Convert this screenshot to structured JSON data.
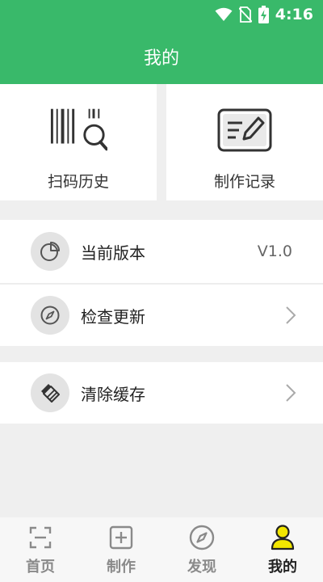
{
  "status_bar": {
    "time": "4:16"
  },
  "header": {
    "title": "我的"
  },
  "cards": [
    {
      "label": "扫码历史",
      "icon": "barcode-scan-icon"
    },
    {
      "label": "制作记录",
      "icon": "edit-note-icon"
    }
  ],
  "menu": {
    "version": {
      "label": "当前版本",
      "value": "V1.0",
      "icon": "pie-chart-icon"
    },
    "check_update": {
      "label": "检查更新",
      "icon": "compass-icon"
    },
    "clear_cache": {
      "label": "清除缓存",
      "icon": "broom-icon"
    }
  },
  "tabs": [
    {
      "label": "首页",
      "icon": "scan-frame-icon"
    },
    {
      "label": "制作",
      "icon": "plus-square-icon"
    },
    {
      "label": "发现",
      "icon": "compass-icon"
    },
    {
      "label": "我的",
      "icon": "person-icon",
      "active": true
    }
  ],
  "colors": {
    "brand": "#39b96a",
    "active_tab_icon": "#f2e600"
  }
}
